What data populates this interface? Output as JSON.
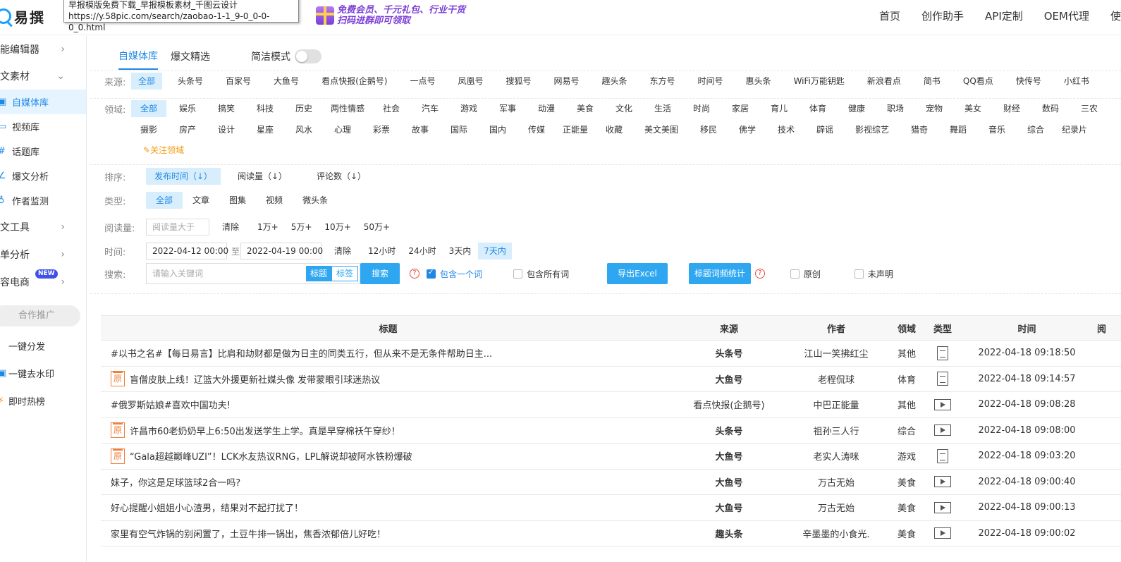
{
  "header": {
    "logo_text": "易撰",
    "tooltip_line1": "早报模版免费下载_早报模板素材_千图云设计",
    "tooltip_line2": "https://y.58pic.com/search/zaobao-1-1_9-0_0-0-0_0.html",
    "promo_line1": "免费会员、千元礼包、行业干货",
    "promo_line2": "扫码进群即可领取",
    "nav": [
      "首页",
      "创作助手",
      "API定制",
      "OEM代理",
      "使"
    ]
  },
  "sidebar": {
    "items": [
      {
        "label": "智能编辑器",
        "arrow": "›"
      },
      {
        "label": "爆文素材",
        "arrow": "⌄"
      }
    ],
    "subitems": [
      {
        "label": "自媒体库",
        "icon": "▣",
        "active": true
      },
      {
        "label": "视频库",
        "icon": "▭"
      },
      {
        "label": "话题库",
        "icon": "#"
      },
      {
        "label": "爆文分析",
        "icon": "∠"
      },
      {
        "label": "作者监测",
        "icon": "♁"
      }
    ],
    "items2": [
      {
        "label": "爆文工具",
        "arrow": "›"
      },
      {
        "label": "榜单分析",
        "arrow": "›"
      },
      {
        "label": "内容电商",
        "arrow": "›",
        "badge": "NEW"
      }
    ],
    "coop_label": "合作推广",
    "extras": [
      {
        "label": "一键分发",
        "icon": ""
      },
      {
        "label": "一键去水印",
        "icon": "▣"
      },
      {
        "label": "即时热榜",
        "icon": "⚡"
      }
    ]
  },
  "tabs": {
    "items": [
      "自媒体库",
      "爆文精选"
    ],
    "simple_mode_label": "简洁模式"
  },
  "filters": {
    "source_label": "来源:",
    "sources": [
      "全部",
      "头条号",
      "百家号",
      "大鱼号",
      "看点快报(企鹅号)",
      "一点号",
      "凤凰号",
      "搜狐号",
      "网易号",
      "趣头条",
      "东方号",
      "时间号",
      "惠头条",
      "WiFi万能钥匙",
      "新浪看点",
      "简书",
      "QQ看点",
      "快传号",
      "小红书"
    ],
    "field_label": "领域:",
    "fields_row1": [
      "全部",
      "娱乐",
      "搞笑",
      "科技",
      "历史",
      "两性情感",
      "社会",
      "汽车",
      "游戏",
      "军事",
      "动漫",
      "美食",
      "文化",
      "生活",
      "时尚",
      "家居",
      "育儿",
      "体育",
      "健康",
      "职场",
      "宠物",
      "美女",
      "财经",
      "数码",
      "三农"
    ],
    "fields_row2": [
      "摄影",
      "房产",
      "设计",
      "星座",
      "风水",
      "心理",
      "彩票",
      "故事",
      "国际",
      "国内",
      "传媒",
      "正能量",
      "收藏",
      "美文美图",
      "移民",
      "佛学",
      "技术",
      "辟谣",
      "影视综艺",
      "猎奇",
      "舞蹈",
      "音乐",
      "综合",
      "纪录片"
    ],
    "follow_field": "关注领域",
    "sort_label": "排序:",
    "sorts": [
      "发布时间（↓）",
      "阅读量（↓）",
      "评论数（↓）"
    ],
    "type_label": "类型:",
    "types": [
      "全部",
      "文章",
      "图集",
      "视频",
      "微头条"
    ],
    "read_label": "阅读量:",
    "read_placeholder": "阅读量大于",
    "read_clear": "清除",
    "read_opts": [
      "1万+",
      "5万+",
      "10万+",
      "50万+"
    ],
    "time_label": "时间:",
    "date_from": "2022-04-12 00:00",
    "date_to_sep": "至",
    "date_to": "2022-04-19 00:00",
    "time_clear": "清除",
    "time_opts": [
      "12小时",
      "24小时",
      "3天内",
      "7天内"
    ],
    "search_label": "搜索:",
    "search_placeholder": "请输入关键词",
    "search_mode_title": "标题",
    "search_mode_tag": "标签",
    "search_button": "搜索",
    "contain_one": "包含一个词",
    "contain_all": "包含所有词",
    "export_button": "导出Excel",
    "title_stats_button": "标题词频统计",
    "original": "原创",
    "undeclared": "未声明"
  },
  "table": {
    "headers": [
      "标题",
      "来源",
      "作者",
      "领域",
      "类型",
      "时间",
      "阅"
    ],
    "rows": [
      {
        "title": "#以书之名#【每日易言】比肩和劫财都是做为日主的同类五行，但从来不是无条件帮助日主...",
        "original": false,
        "source": "头条号",
        "author": "江山一笑拂红尘",
        "field": "其他",
        "type": "doc",
        "time": "2022-04-18 09:18:50"
      },
      {
        "title": "盲僧皮肤上线！辽篮大外援更新社媒头像 发带蒙眼引球迷热议",
        "original": true,
        "source": "大鱼号",
        "author": "老程侃球",
        "field": "体育",
        "type": "doc",
        "time": "2022-04-18 09:14:57"
      },
      {
        "title": "#俄罗斯姑娘#喜欢中国功夫!",
        "original": false,
        "source": "看点快报(企鹅号)",
        "author": "中巴正能量",
        "field": "其他",
        "type": "video",
        "time": "2022-04-18 09:08:28"
      },
      {
        "title": "许昌市60老奶奶早上6:50出发送学生上学。真是早穿棉袄午穿纱！",
        "original": true,
        "source": "头条号",
        "author": "祖孙三人行",
        "field": "综合",
        "type": "video",
        "time": "2022-04-18 09:08:00"
      },
      {
        "title": "“Gala超越巅峰UZI”！LCK水友热议RNG，LPL解说却被阿水铁粉爆破",
        "original": true,
        "source": "大鱼号",
        "author": "老实人涛咪",
        "field": "游戏",
        "type": "doc",
        "time": "2022-04-18 09:03:20"
      },
      {
        "title": "妹子，你这是足球篮球2合一吗?",
        "original": false,
        "source": "大鱼号",
        "author": "万古无始",
        "field": "美食",
        "type": "video",
        "time": "2022-04-18 09:00:40"
      },
      {
        "title": "好心提醒小姐姐小心渣男，结果对不起打扰了！",
        "original": false,
        "source": "大鱼号",
        "author": "万古无始",
        "field": "美食",
        "type": "video",
        "time": "2022-04-18 09:00:13"
      },
      {
        "title": "家里有空气炸锅的别闲置了，土豆牛排一锅出，焦香浓郁倍儿好吃！",
        "original": false,
        "source": "趣头条",
        "author": "辛墨墨的小食光.",
        "field": "美食",
        "type": "video",
        "time": "2022-04-18 09:00:02"
      }
    ]
  },
  "colors": {
    "accent": "#1e88e5",
    "button": "#2ea7f0",
    "original_badge": "#f07f3b"
  }
}
